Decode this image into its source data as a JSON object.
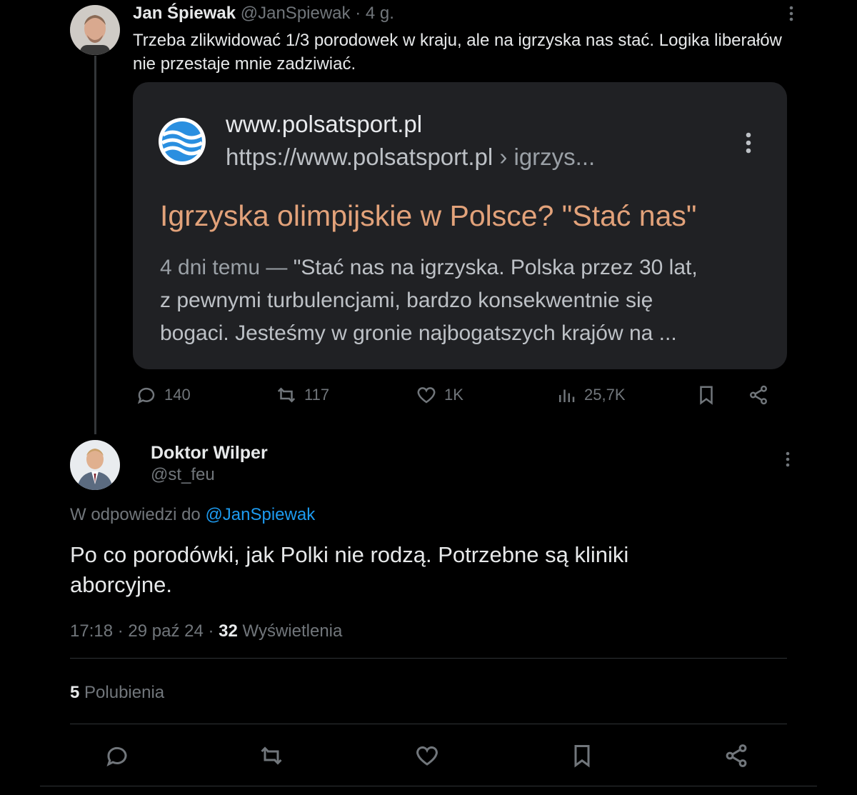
{
  "original_tweet": {
    "author_name": "Jan Śpiewak",
    "handle": "@JanSpiewak",
    "time": "· 4 g.",
    "text": "Trzeba zlikwidować 1/3 porodowek w kraju, ale na igrzyska nas stać. Logika liberałów nie przestaje mnie zadziwiać.",
    "card": {
      "site_name": "www.polsatsport.pl",
      "url": "https://www.polsatsport.pl",
      "url_path": "› igrzys...",
      "title": "Igrzyska olimpijskie w Polsce? \"Stać nas\"",
      "date": "4 dni temu —",
      "snippet_1": "\"Stać nas na igrzyska. Polska przez 30 lat,",
      "snippet_2": "z pewnymi turbulencjami, bardzo konsekwentnie się",
      "snippet_3": "bogaci. Jesteśmy w gronie najbogatszych krajów na ..."
    },
    "stats": {
      "replies": "140",
      "reposts": "117",
      "likes": "1K",
      "views": "25,7K"
    }
  },
  "reply_tweet": {
    "author_name": "Doktor Wilper",
    "handle": "@st_feu",
    "reply_prefix": "W odpowiedzi do",
    "reply_to": "@JanSpiewak",
    "text": "Po co porodówki, jak Polki nie rodzą. Potrzebne są kliniki aborcyjne.",
    "timestamp": "17:18 · 29 paź 24 ·",
    "views_count": "32",
    "views_label": "Wyświetlenia",
    "likes_count": "5",
    "likes_label": "Polubienia"
  },
  "colors": {
    "background": "#000000",
    "text": "#e7e9ea",
    "muted": "#71767b",
    "link": "#1d9bf0",
    "card_bg": "#202124",
    "card_title": "#e2a27a"
  },
  "icons": [
    "more-icon",
    "reply-icon",
    "repost-icon",
    "like-icon",
    "views-icon",
    "bookmark-icon",
    "share-icon",
    "polsat-logo-icon"
  ]
}
